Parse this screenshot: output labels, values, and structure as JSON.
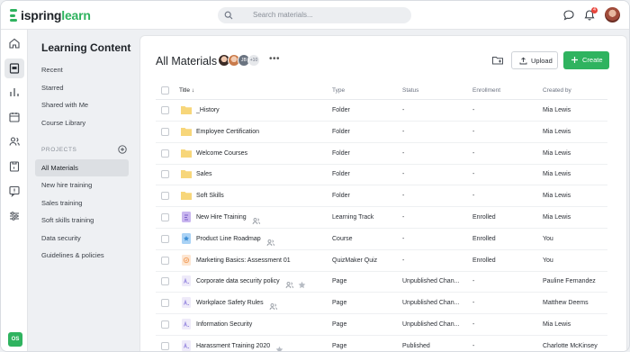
{
  "app": {
    "logo_main": "ispring",
    "logo_accent": "learn"
  },
  "search": {
    "placeholder": "Search materials..."
  },
  "notifications": {
    "count": "4"
  },
  "user": {
    "initials": "OS"
  },
  "sidebar": {
    "title": "Learning Content",
    "items": [
      "Recent",
      "Starred",
      "Shared with Me",
      "Course Library"
    ],
    "projects_label": "PROJECTS",
    "projects": [
      "All Materials",
      "New hire training",
      "Sales training",
      "Soft skills training",
      "Data security",
      "Guidelines & policies"
    ]
  },
  "main": {
    "title": "All Materials",
    "collaborators_more": "+10",
    "collaborator_initials": "JB",
    "upload_label": "Upload",
    "create_label": "Create"
  },
  "table": {
    "columns": [
      "Title",
      "Type",
      "Status",
      "Enrollment",
      "Created by"
    ],
    "rows": [
      {
        "icon": "folder-icon",
        "name": "_History",
        "type": "Folder",
        "status": "-",
        "enrollment": "-",
        "created_by": "Mia Lewis"
      },
      {
        "icon": "folder-icon",
        "name": "Employee Certification",
        "type": "Folder",
        "status": "-",
        "enrollment": "-",
        "created_by": "Mia Lewis"
      },
      {
        "icon": "folder-icon",
        "name": "Welcome Courses",
        "type": "Folder",
        "status": "-",
        "enrollment": "-",
        "created_by": "Mia Lewis"
      },
      {
        "icon": "folder-icon",
        "name": "Sales",
        "type": "Folder",
        "status": "-",
        "enrollment": "-",
        "created_by": "Mia Lewis"
      },
      {
        "icon": "folder-icon",
        "name": "Soft Skills",
        "type": "Folder",
        "status": "-",
        "enrollment": "-",
        "created_by": "Mia Lewis"
      },
      {
        "icon": "learning-track-icon",
        "name": "New Hire Training",
        "type": "Learning Track",
        "status": "-",
        "enrollment": "Enrolled",
        "created_by": "Mia Lewis",
        "shared": true
      },
      {
        "icon": "course-icon",
        "name": "Product Line Roadmap",
        "type": "Course",
        "status": "-",
        "enrollment": "Enrolled",
        "created_by": "You",
        "shared": true
      },
      {
        "icon": "quiz-icon",
        "name": "Marketing Basics: Assessment 01",
        "type": "QuizMaker Quiz",
        "status": "-",
        "enrollment": "Enrolled",
        "created_by": "You"
      },
      {
        "icon": "page-icon",
        "name": "Corporate data security policy",
        "type": "Page",
        "status": "Unpublished Chan...",
        "enrollment": "-",
        "created_by": "Pauline Fernandez",
        "shared": true,
        "starred": true
      },
      {
        "icon": "page-icon",
        "name": "Workplace Safety Rules",
        "type": "Page",
        "status": "Unpublished Chan...",
        "enrollment": "-",
        "created_by": "Matthew Deems",
        "shared": true
      },
      {
        "icon": "page-icon",
        "name": "Information Security",
        "type": "Page",
        "status": "Unpublished Chan...",
        "enrollment": "-",
        "created_by": "Mia Lewis"
      },
      {
        "icon": "page-icon",
        "name": "Harassment Training 2020",
        "type": "Page",
        "status": "Published",
        "enrollment": "-",
        "created_by": "Charlotte McKinsey",
        "starred": true
      }
    ]
  },
  "colors": {
    "accent": "#2fb35f",
    "folder": "#f7d67a",
    "track": "#c9b6ef",
    "course": "#a9d2f5",
    "quiz": "#f3a76a",
    "page": "#9a8ce0"
  }
}
